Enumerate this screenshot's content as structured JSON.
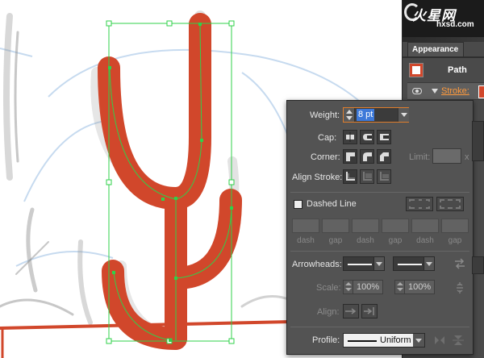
{
  "brand": {
    "name": "火星网",
    "site": "hxsd.com"
  },
  "appearance": {
    "tab_label": "Appearance",
    "object_label": "Path",
    "stroke_label": "Stroke:"
  },
  "stroke_panel": {
    "weight_label": "Weight:",
    "weight_value": "8 pt",
    "cap_label": "Cap:",
    "corner_label": "Corner:",
    "limit_label": "Limit:",
    "limit_unit": "x",
    "align_label": "Align Stroke:",
    "dashed_label": "Dashed Line",
    "dash_labels": [
      "dash",
      "gap",
      "dash",
      "gap",
      "dash",
      "gap"
    ],
    "arrowheads_label": "Arrowheads:",
    "scale_label": "Scale:",
    "scale_start": "100%",
    "scale_end": "100%",
    "align_arrow_label": "Align:",
    "profile_label": "Profile:",
    "profile_value": "Uniform"
  },
  "colors": {
    "stroke": "#d1472b",
    "selection": "#2fd14a",
    "accent": "#e07d2b"
  }
}
